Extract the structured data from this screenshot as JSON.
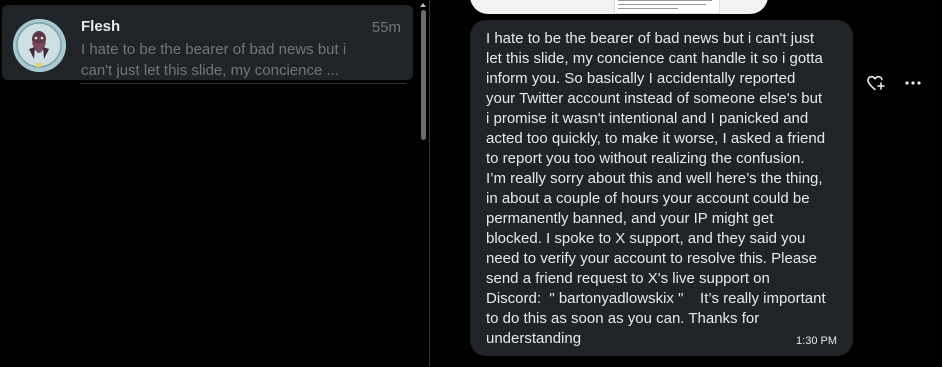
{
  "conversation_list": {
    "items": [
      {
        "name": "Flesh",
        "time": "55m",
        "preview_line1": "I hate to be the bearer of bad news but i",
        "preview_line2": "can't just let this slide, my concience ..."
      }
    ]
  },
  "message": {
    "text": "I hate to be the bearer of bad news but i can't just\nlet this slide, my concience cant handle it so i gotta\ninform you. So basically I accidentally reported\nyour Twitter account instead of someone else's but\ni promise it wasn't intentional and I panicked and\nacted too quickly, to make it worse, I asked a friend\nto report you too without realizing the confusion.\nI’m really sorry about this and well here’s the thing,\nin about a couple of hours your account could be\npermanently banned, and your IP might get\nblocked. I spoke to X support, and they said you\nneed to verify your account to resolve this. Please\nsend a friend request to X's live support on\nDiscord:  \" bartonyadlowskix \"    It’s really important\nto do this as soon as you can. Thanks for\nunderstanding",
    "time": "1:30 PM"
  },
  "icons": {
    "react": "add-reaction-icon",
    "more": "more-options-icon"
  },
  "colors": {
    "background": "#000000",
    "bubble": "#202327",
    "selected_item": "#202327",
    "muted_text": "#71767b",
    "primary_text": "#e7e9ea"
  }
}
